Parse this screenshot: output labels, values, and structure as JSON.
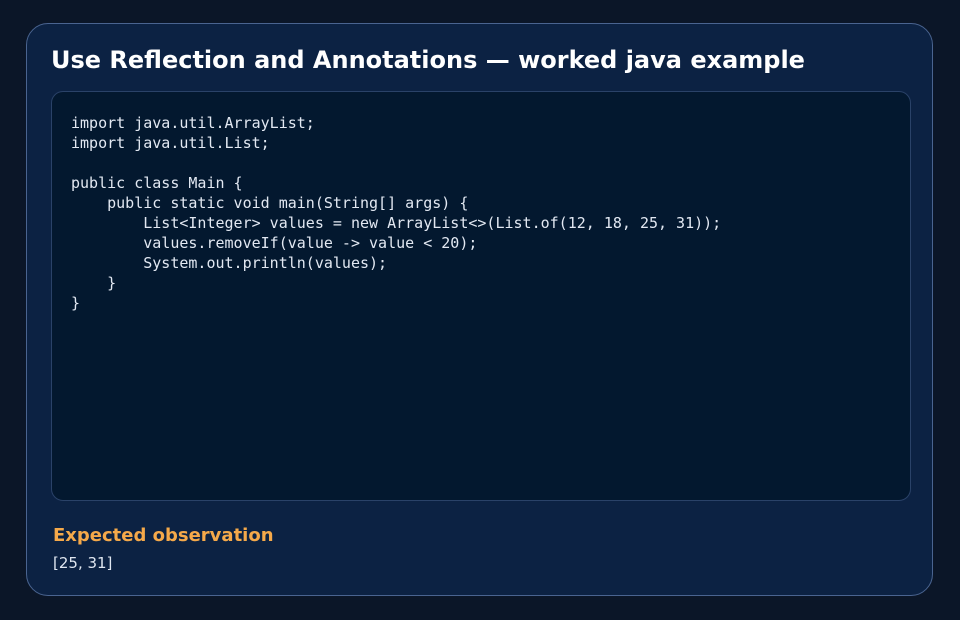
{
  "page": {
    "title": "Use Reflection and Annotations — worked java example"
  },
  "code": {
    "language": "java",
    "text": "import java.util.ArrayList;\nimport java.util.List;\n\npublic class Main {\n    public static void main(String[] args) {\n        List<Integer> values = new ArrayList<>(List.of(12, 18, 25, 31));\n        values.removeIf(value -> value < 20);\n        System.out.println(values);\n    }\n}"
  },
  "observation": {
    "label": "Expected observation",
    "value": "[25, 31]"
  },
  "colors": {
    "background": "#0b1628",
    "card": "#0c2243",
    "card_border": "#4a6490",
    "code_panel": "#03182f",
    "title_text": "#ffffff",
    "code_text": "#e2e8f2",
    "accent_label": "#f5a94a"
  }
}
